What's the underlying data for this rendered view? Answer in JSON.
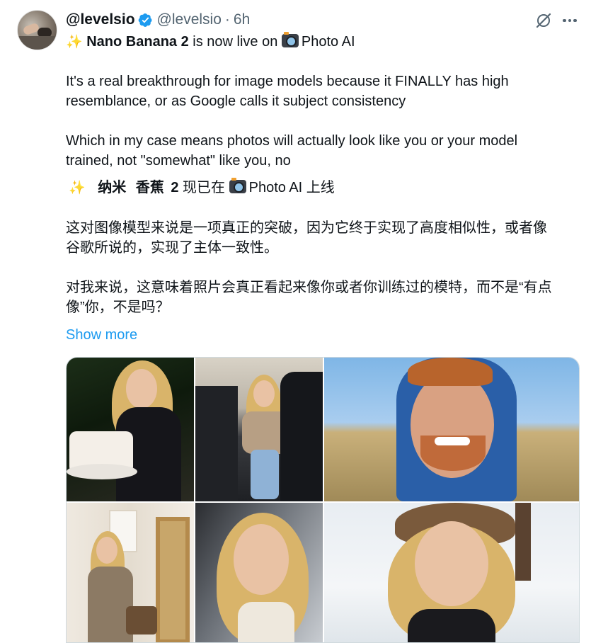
{
  "tweet": {
    "author_name": "@levelsio",
    "handle": "@levelsio",
    "separator": "·",
    "time": "6h",
    "line1": {
      "emoji": "✨",
      "bold": "Nano Banana 2",
      "rest": " is now live on ",
      "camera_label": "Photo AI"
    },
    "para1_l1": "It's a real breakthrough for image models because  it FINALLY has high",
    "para1_l2": "resemblance, or as Google calls it subject consistency",
    "para2_l1": "Which in my case means photos will actually look like you or your model",
    "para2_l2": "trained, not \"somewhat\" like you, no",
    "translation": {
      "line1": {
        "emoji": "✨",
        "bold1": "纳米",
        "bold2": "香蕉",
        "bold3": "2",
        "rest": " 现已在 ",
        "tail": "Photo AI 上线"
      },
      "para1_l1": "这对图像模型来说是一项真正的突破，因为它终于实现了高度相似性，或者像",
      "para1_l2": "谷歌所说的，实现了主体一致性。",
      "para2_l1": "对我来说，这意味着照片会真正看起来像你或者你训练过的模特，而不是“有点",
      "para2_l2": "像”你，不是吗？"
    },
    "show_more": "Show more"
  },
  "icons": {
    "verified": "verified-badge-icon",
    "grok": "grok-icon",
    "more": "more-options-icon",
    "camera": "camera-emoji-icon"
  },
  "colors": {
    "link": "#1d9bf0",
    "verified": "#1d9bf0",
    "secondary_text": "#536471"
  }
}
